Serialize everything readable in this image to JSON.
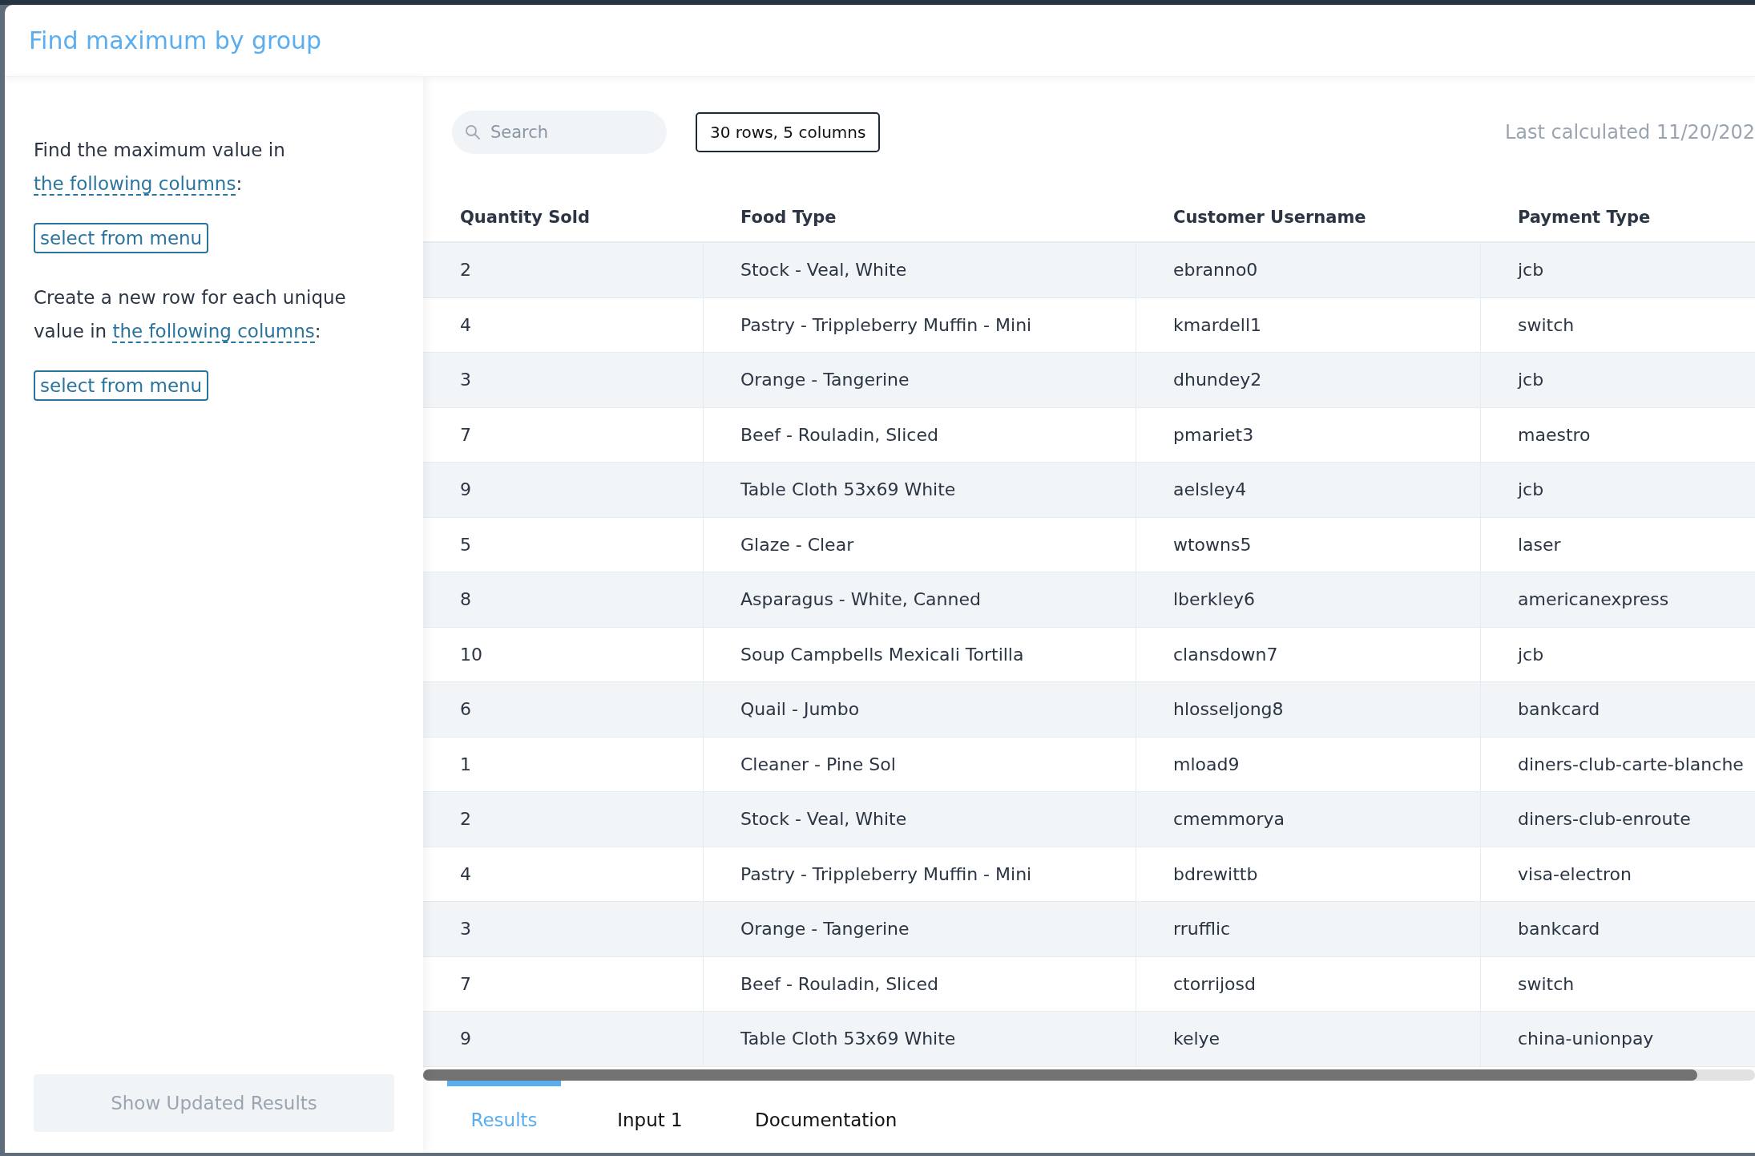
{
  "header": {
    "title": "Find maximum by group"
  },
  "sidebar": {
    "sections": [
      {
        "text": "Find the maximum value in",
        "link": "the following columns",
        "after": ":",
        "button": "select from menu"
      },
      {
        "text": "Create a new row for each unique value in",
        "link": "the following columns",
        "after": ":",
        "button": "select from menu"
      }
    ],
    "action_button": {
      "label": "Show Updated Results",
      "disabled": true
    }
  },
  "toolbar": {
    "search": {
      "placeholder": "Search"
    },
    "summary": "30 rows, 5 columns",
    "last_calculated": "Last calculated 11/20/202"
  },
  "table": {
    "columns": [
      "Quantity Sold",
      "Food Type",
      "Customer Username",
      "Payment Type"
    ],
    "rows": [
      [
        "2",
        "Stock - Veal, White",
        "ebranno0",
        "jcb"
      ],
      [
        "4",
        "Pastry - Trippleberry Muffin - Mini",
        "kmardell1",
        "switch"
      ],
      [
        "3",
        "Orange - Tangerine",
        "dhundey2",
        "jcb"
      ],
      [
        "7",
        "Beef - Rouladin, Sliced",
        "pmariet3",
        "maestro"
      ],
      [
        "9",
        "Table Cloth 53x69 White",
        "aelsley4",
        "jcb"
      ],
      [
        "5",
        "Glaze - Clear",
        "wtowns5",
        "laser"
      ],
      [
        "8",
        "Asparagus - White, Canned",
        "lberkley6",
        "americanexpress"
      ],
      [
        "10",
        "Soup Campbells Mexicali Tortilla",
        "clansdown7",
        "jcb"
      ],
      [
        "6",
        "Quail - Jumbo",
        "hlosseljong8",
        "bankcard"
      ],
      [
        "1",
        "Cleaner - Pine Sol",
        "mload9",
        "diners-club-carte-blanche"
      ],
      [
        "2",
        "Stock - Veal, White",
        "cmemmorya",
        "diners-club-enroute"
      ],
      [
        "4",
        "Pastry - Trippleberry Muffin - Mini",
        "bdrewittb",
        "visa-electron"
      ],
      [
        "3",
        "Orange - Tangerine",
        "rrufflic",
        "bankcard"
      ],
      [
        "7",
        "Beef - Rouladin, Sliced",
        "ctorrijosd",
        "switch"
      ],
      [
        "9",
        "Table Cloth 53x69 White",
        "kelye",
        "china-unionpay"
      ]
    ]
  },
  "tabs": [
    {
      "label": "Results",
      "selected": true
    },
    {
      "label": "Input 1",
      "selected": false
    },
    {
      "label": "Documentation",
      "selected": false
    }
  ]
}
